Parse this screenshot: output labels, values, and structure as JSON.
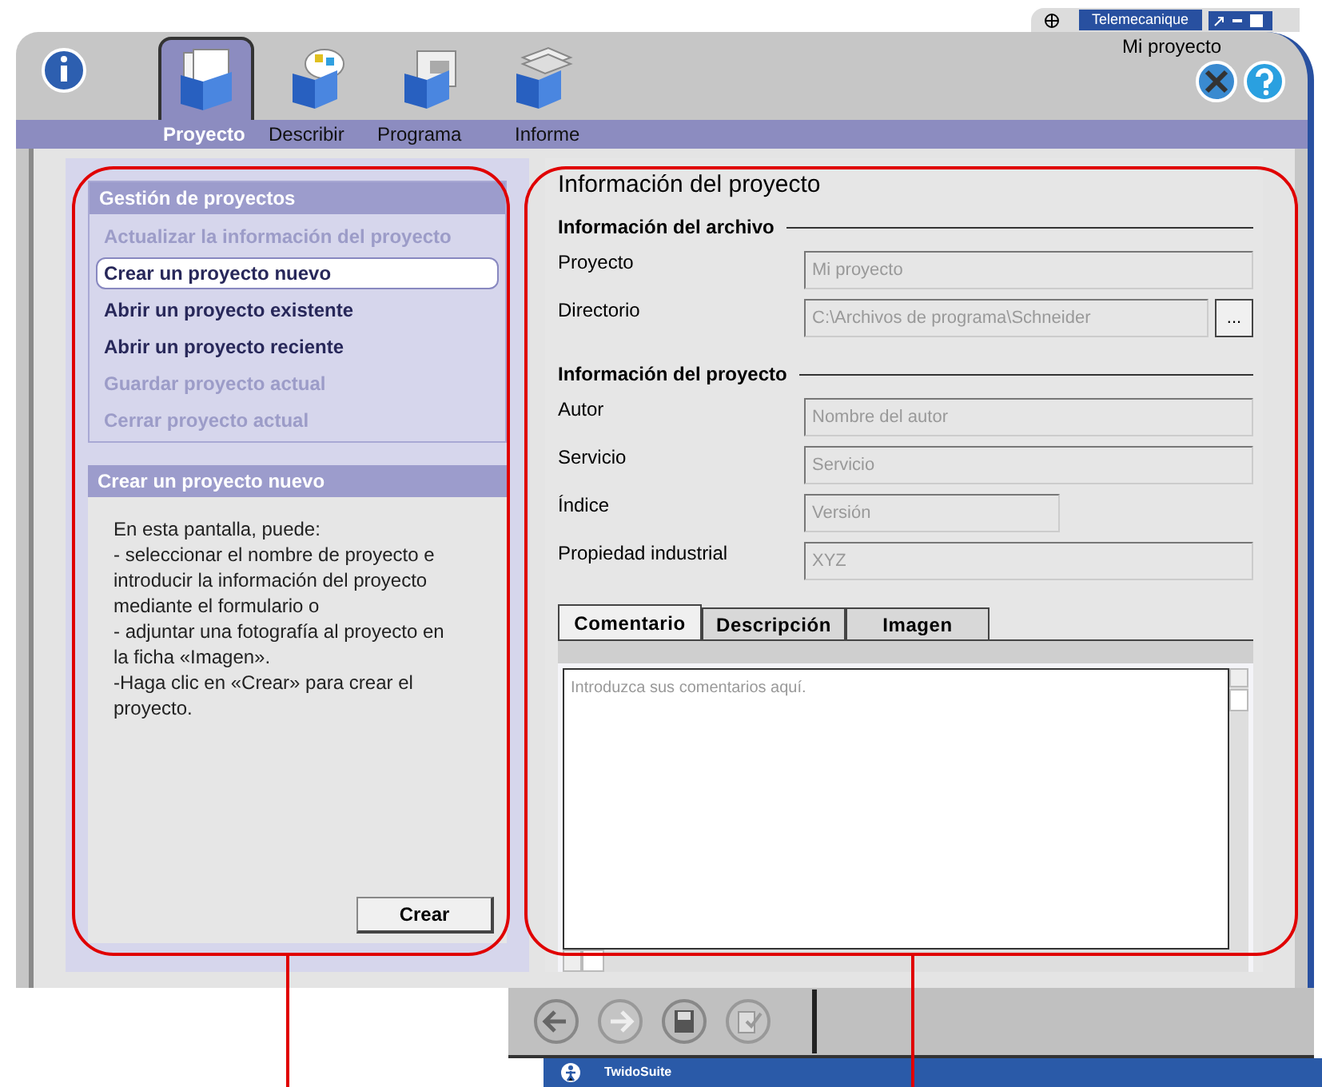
{
  "top_bar": {
    "brand": "Telemecanique",
    "project": "Mi proyecto"
  },
  "main_tabs": [
    {
      "label": "Proyecto",
      "selected": true
    },
    {
      "label": "Describir",
      "selected": false
    },
    {
      "label": "Programa",
      "selected": false
    },
    {
      "label": "Informe",
      "selected": false
    }
  ],
  "project_menu": {
    "title": "Gestión de proyectos",
    "items": [
      {
        "label": "Actualizar la información del proyecto",
        "disabled": true,
        "selected": false
      },
      {
        "label": "Crear un proyecto nuevo",
        "disabled": false,
        "selected": true
      },
      {
        "label": "Abrir un proyecto existente",
        "disabled": false,
        "selected": false
      },
      {
        "label": "Abrir un proyecto reciente",
        "disabled": false,
        "selected": false
      },
      {
        "label": "Guardar proyecto actual",
        "disabled": true,
        "selected": false
      },
      {
        "label": "Cerrar proyecto actual",
        "disabled": true,
        "selected": false
      }
    ]
  },
  "help_panel": {
    "title": "Crear un proyecto nuevo",
    "lines": [
      "En esta pantalla, puede:",
      "- seleccionar el nombre de proyecto e introducir la información del proyecto mediante el formulario o",
      "- adjuntar una fotografía al proyecto en la ficha «Imagen».",
      "-Haga clic en «Crear» para crear el proyecto."
    ],
    "button": "Crear"
  },
  "form": {
    "title": "Información del proyecto",
    "sections": [
      {
        "heading": "Información del archivo",
        "fields": [
          {
            "kind": "text",
            "label": "Proyecto",
            "placeholder": "Mi proyecto"
          },
          {
            "kind": "browse",
            "label": "Directorio",
            "placeholder": "C:\\Archivos de programa\\Schneider",
            "button": "..."
          }
        ]
      },
      {
        "heading": "Información del proyecto",
        "fields": [
          {
            "kind": "text",
            "label": "Autor",
            "placeholder": "Nombre del autor"
          },
          {
            "kind": "text",
            "label": "Servicio",
            "placeholder": "Servicio"
          },
          {
            "kind": "short",
            "label": "Índice",
            "placeholder": "Versión"
          },
          {
            "kind": "text",
            "label": "Propiedad industrial",
            "placeholder": "XYZ"
          }
        ]
      }
    ]
  },
  "detail_tabs": [
    {
      "label": "Comentario",
      "selected": true
    },
    {
      "label": "Descripción",
      "selected": false
    },
    {
      "label": "Imagen",
      "selected": false
    }
  ],
  "comment": {
    "placeholder": "Introduzca sus comentarios aquí."
  },
  "status_bar": {
    "app": "TwidoSuite"
  }
}
